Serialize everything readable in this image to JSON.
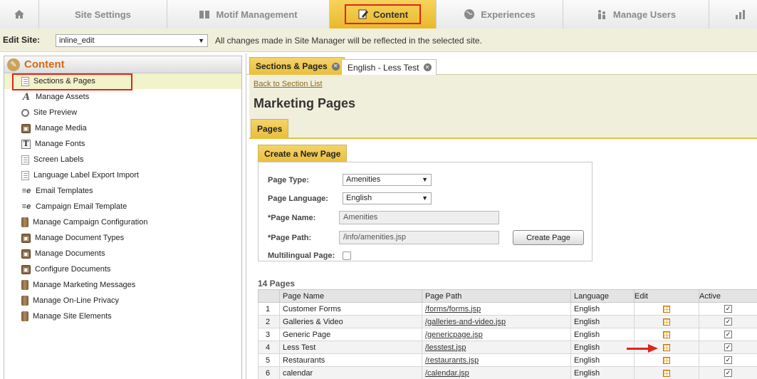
{
  "topnav": {
    "tabs": [
      {
        "label": "Site Settings"
      },
      {
        "label": "Motif Management"
      },
      {
        "label": "Content"
      },
      {
        "label": "Experiences"
      },
      {
        "label": "Manage Users"
      }
    ]
  },
  "sitebar": {
    "label": "Edit Site:",
    "selected_site": "inline_edit",
    "note": "All changes made in Site Manager will be reflected in the selected site."
  },
  "sidebar": {
    "title": "Content",
    "items": [
      {
        "label": "Sections & Pages",
        "icon": "document-icon"
      },
      {
        "label": "Manage Assets",
        "icon": "font-icon"
      },
      {
        "label": "Site Preview",
        "icon": "magnifier-icon"
      },
      {
        "label": "Manage Media",
        "icon": "media-icon"
      },
      {
        "label": "Manage Fonts",
        "icon": "text-icon"
      },
      {
        "label": "Screen Labels",
        "icon": "document-icon"
      },
      {
        "label": "Language Label Export Import",
        "icon": "document-icon"
      },
      {
        "label": "Email Templates",
        "icon": "email-icon"
      },
      {
        "label": "Campaign Email Template",
        "icon": "email-icon"
      },
      {
        "label": "Manage Campaign Configuration",
        "icon": "database-icon"
      },
      {
        "label": "Manage Document Types",
        "icon": "media-icon"
      },
      {
        "label": "Manage Documents",
        "icon": "media-icon"
      },
      {
        "label": "Configure Documents",
        "icon": "media-icon"
      },
      {
        "label": "Manage Marketing Messages",
        "icon": "database-icon"
      },
      {
        "label": "Manage On-Line Privacy",
        "icon": "database-icon"
      },
      {
        "label": "Manage Site Elements",
        "icon": "database-icon"
      }
    ]
  },
  "main": {
    "tabs": [
      {
        "label": "Sections & Pages"
      },
      {
        "label": "English - Less Test"
      }
    ],
    "back_link": "Back to Section List",
    "title": "Marketing Pages",
    "subtab": "Pages",
    "form": {
      "tab": "Create a New Page",
      "page_type_label": "Page Type:",
      "page_type_value": "Amenities",
      "page_language_label": "Page Language:",
      "page_language_value": "English",
      "page_name_label": "*Page Name:",
      "page_name_value": "Amenities",
      "page_path_label": "*Page Path:",
      "page_path_value": "/info/amenities.jsp",
      "multilingual_label": "Multilingual Page:",
      "create_button": "Create Page"
    },
    "count": "14 Pages",
    "table": {
      "headers": [
        "Page Name",
        "Page Path",
        "Language",
        "Edit",
        "Active"
      ],
      "rows": [
        {
          "num": "1",
          "name": "Customer Forms",
          "path": "/forms/forms.jsp",
          "lang": "English"
        },
        {
          "num": "2",
          "name": "Galleries & Video",
          "path": "/galleries-and-video.jsp",
          "lang": "English"
        },
        {
          "num": "3",
          "name": "Generic Page",
          "path": "/genericpage.jsp",
          "lang": "English"
        },
        {
          "num": "4",
          "name": "Less Test",
          "path": "/lesstest.jsp",
          "lang": "English"
        },
        {
          "num": "5",
          "name": "Restaurants",
          "path": "/restaurants.jsp",
          "lang": "English"
        },
        {
          "num": "6",
          "name": "calendar",
          "path": "/calendar.jsp",
          "lang": "English"
        }
      ]
    }
  },
  "colors": {
    "accent_yellow": "#e9bf3c",
    "highlight_red": "#e0241b",
    "section_title": "#d36b12",
    "panel_bg": "#f0efdc"
  }
}
